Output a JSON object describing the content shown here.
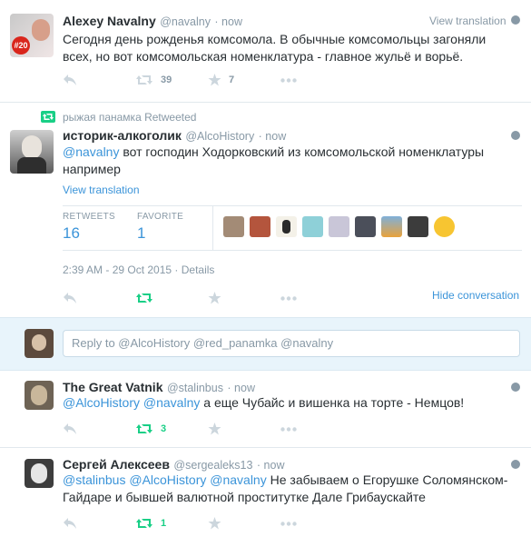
{
  "tweet1": {
    "name": "Alexey Navalny",
    "handle": "@navalny",
    "time": "· now",
    "view_translation": "View translation",
    "text": "Сегодня день рожденья комсомола. В обычные комсомольцы загоняли всех, но вот комсомольская номенклатура - главное жульё и ворьё.",
    "retweets": "39",
    "favorites": "7"
  },
  "tweet2": {
    "retweeted_by": "рыжая панамка Retweeted",
    "name": "историк-алкоголик",
    "handle": "@AlcoHistory",
    "time": "· now",
    "mention": "@navalny",
    "text": " вот господин Ходорковский из комсомольской номенклатуры например",
    "view_translation": "View translation",
    "retweets_label": "RETWEETS",
    "retweets_value": "16",
    "favorite_label": "FAVORITE",
    "favorite_value": "1",
    "timestamp": "2:39 AM - 29 Oct 2015",
    "details": "· Details",
    "hide_conversation": "Hide conversation"
  },
  "reply_box": {
    "placeholder": "Reply to @AlcoHistory @red_panamka @navalny"
  },
  "tweet3": {
    "name": "The Great Vatnik",
    "handle": "@stalinbus",
    "time": "· now",
    "mentions": "@AlcoHistory @navalny",
    "text": " а еще Чубайс и вишенка на торте - Немцов!",
    "retweets": "3"
  },
  "tweet4": {
    "name": "Сергей Алексеев",
    "handle": "@sergealeks13",
    "time": "· now",
    "mentions": "@stalinbus @AlcoHistory @navalny",
    "text_line1": " Не забываем о Егорушке Соломянском-",
    "text_line2": "Гайдаре и бывшей валютной проститутке Дале Грибаускайте",
    "retweets": "1"
  },
  "colors": {
    "link": "#3b94d9",
    "retweet_green": "#19cf86",
    "icon_gray": "#ccd6dd",
    "text_gray": "#8899a6"
  }
}
